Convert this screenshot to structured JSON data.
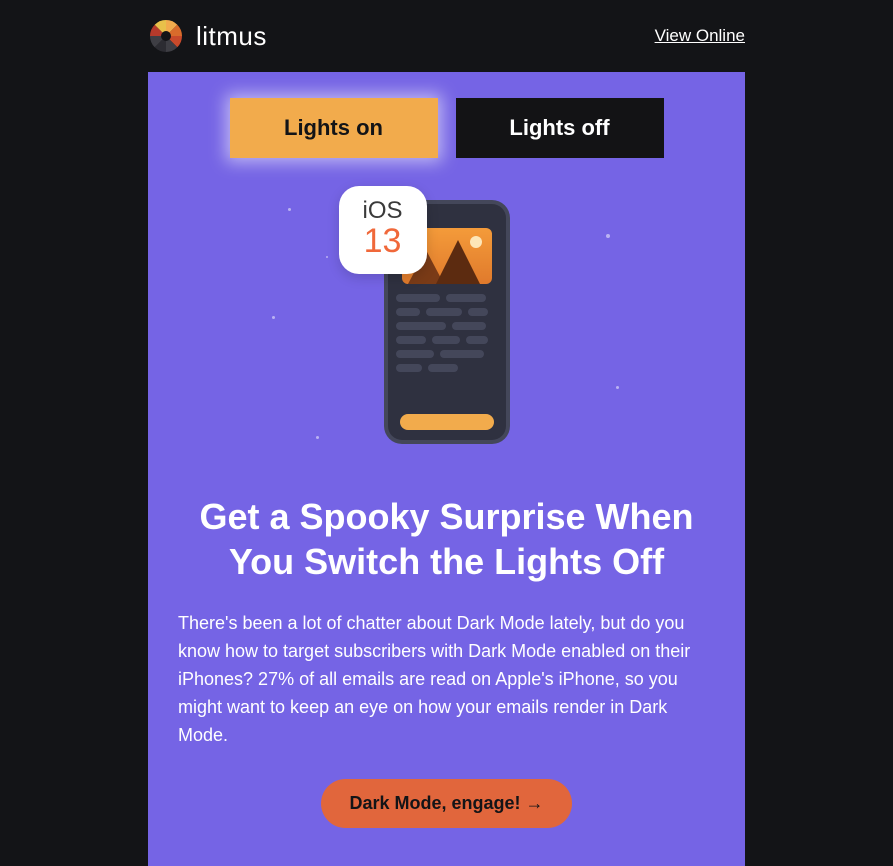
{
  "brand": {
    "name": "litmus"
  },
  "header": {
    "view_online": "View Online"
  },
  "toggle": {
    "on_label": "Lights on",
    "off_label": "Lights off"
  },
  "badge": {
    "line1": "iOS",
    "line2": "13"
  },
  "heading": "Get a Spooky Surprise When You Switch the Lights Off",
  "body": "There's been a lot of chatter about Dark Mode lately, but do you know how to target subscribers with Dark Mode enabled on their iPhones? 27% of all emails are read on Apple's iPhone, so you might want to keep an eye on how your emails render in Dark Mode.",
  "cta": "Dark Mode, engage! →",
  "colors": {
    "page_bg": "#131417",
    "card_bg": "#7564E5",
    "accent_amber": "#F2AB4C",
    "accent_orange": "#E1663C",
    "toggle_off_bg": "#131315"
  }
}
